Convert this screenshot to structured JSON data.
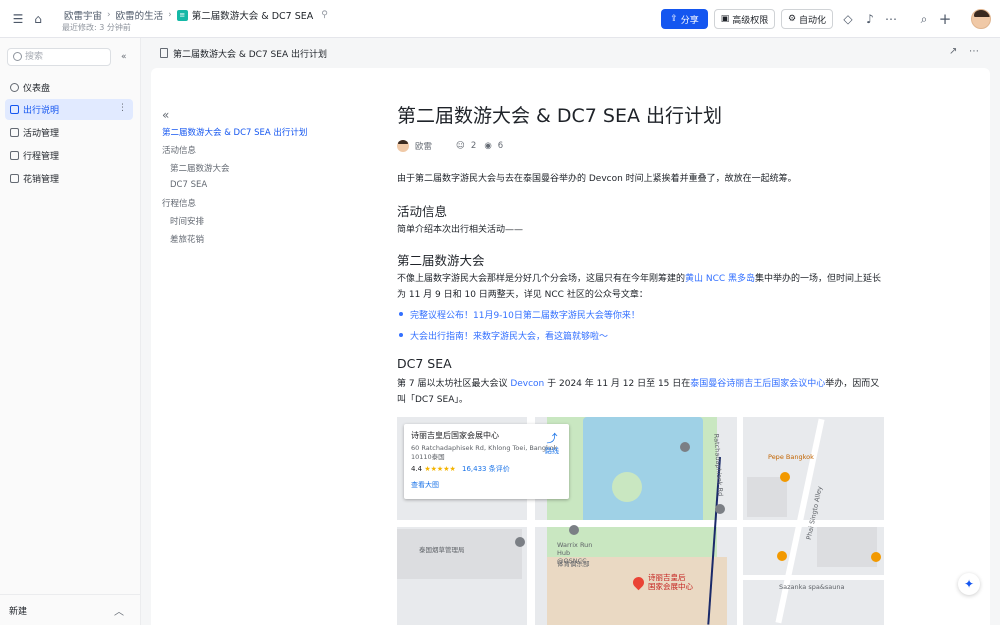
{
  "breadcrumbs": [
    "欧雷宇宙",
    "欧雷的生活",
    "第二届数游大会 & DC7 SEA"
  ],
  "last_edited": "最近修改: 3 分钟前",
  "toolbar": {
    "share": "分享",
    "permissions": "高级权限",
    "automation": "自动化"
  },
  "sidebar": {
    "search_placeholder": "搜索",
    "items": [
      {
        "label": "仪表盘",
        "active": false
      },
      {
        "label": "出行说明",
        "active": true
      },
      {
        "label": "活动管理",
        "active": false
      },
      {
        "label": "行程管理",
        "active": false
      },
      {
        "label": "花销管理",
        "active": false
      }
    ],
    "new_label": "新建"
  },
  "doc_header_title": "第二届数游大会 & DC7 SEA 出行计划",
  "toc": [
    {
      "label": "第二届数游大会 & DC7 SEA 出行计划",
      "level": 0,
      "active": true
    },
    {
      "label": "活动信息",
      "level": 0
    },
    {
      "label": "第二届数游大会",
      "level": 1
    },
    {
      "label": "DC7 SEA",
      "level": 1
    },
    {
      "label": "行程信息",
      "level": 0
    },
    {
      "label": "时间安排",
      "level": 1
    },
    {
      "label": "差旅花销",
      "level": 1
    }
  ],
  "doc": {
    "title": "第二届数游大会 & DC7 SEA 出行计划",
    "author": "欧雷",
    "collaborators": "2",
    "views": "6",
    "intro": "由于第二届数字游民大会与去在泰国曼谷举办的 Devcon 时间上紧挨着并重叠了，故放在一起统筹。",
    "h_activity": "活动信息",
    "activity_desc": "简单介绍本次出行相关活动——",
    "h_nomad": "第二届数游大会",
    "nomad_p1": "不像上届数字游民大会那样是分好几个分会场，这届只有在今年刚筹建的",
    "nomad_link": "黄山 NCC 黑多岛",
    "nomad_p2": "集中举办的一场，但时间上延长为 11 月 9 日和 10 日两整天，详见 NCC 社区的公众号文章：",
    "links": [
      "完整议程公布！11月9-10日第二届数字游民大会等你来！",
      "大会出行指南！来数字游民大会，看这篇就够啦～"
    ],
    "h_dc7": "DC7 SEA",
    "dc7_p1": "第 7 届以太坊社区最大会议 ",
    "dc7_link1": "Devcon",
    "dc7_p2": " 于 2024 年 11 月 12 日至 15 日在",
    "dc7_link2": "泰国曼谷诗丽吉王后国家会议中心",
    "dc7_p3": "举办，因而又叫「DC7 SEA」。"
  },
  "map": {
    "place_name": "诗丽吉皇后国家会展中心",
    "address": "60 Ratchadaphisek Rd, Khlong Toei, Bangkok 10110泰国",
    "rating": "4.4",
    "stars": "★★★★★",
    "reviews": "16,433 条评价",
    "view_larger": "查看大图",
    "directions": "路线",
    "labels": [
      "泰国烟草管理局",
      "Warrix Run Hub @QSNCC",
      "体育俱乐部",
      "Pepe Bangkok",
      "Sazanka spa&sauna",
      "Phai Singto Alley",
      "Ratchadaphisek Rd"
    ],
    "venue_label": [
      "诗丽吉皇后",
      "国家会展中心"
    ]
  }
}
